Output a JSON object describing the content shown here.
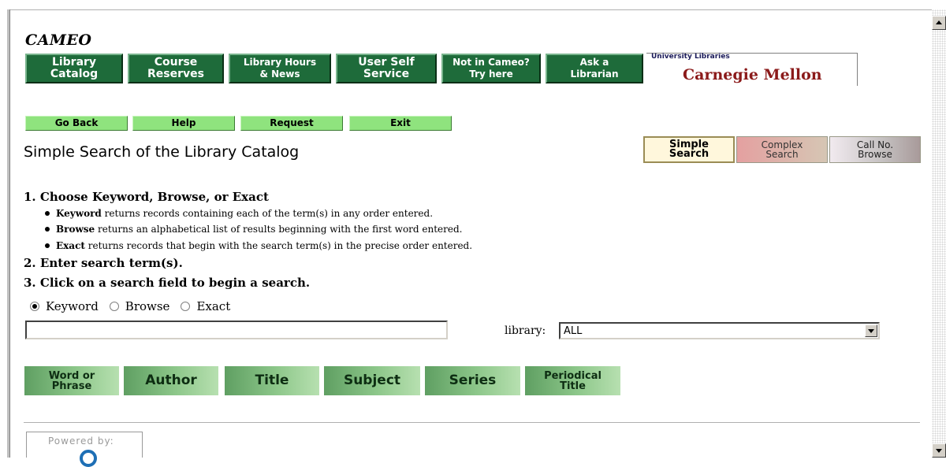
{
  "app": {
    "name": "CAMEO",
    "page_title": "Simple Search of the Library Catalog"
  },
  "nav": {
    "buttons": [
      {
        "label": "Library\nCatalog"
      },
      {
        "label": "Course\nReserves"
      },
      {
        "label": "Library Hours\n& News"
      },
      {
        "label": "User Self\nService"
      },
      {
        "label": "Not in Cameo?\nTry here"
      },
      {
        "label": "Ask a\nLibrarian"
      }
    ],
    "logo_small": "University Libraries",
    "logo_big": "Carnegie Mellon"
  },
  "actions": {
    "go_back": "Go Back",
    "help": "Help",
    "request": "Request",
    "exit": "Exit"
  },
  "tabs": {
    "simple": "Simple\nSearch",
    "complex": "Complex\nSearch",
    "callno": "Call No.\nBrowse"
  },
  "instructions": {
    "step1": "1. Choose Keyword, Browse, or Exact",
    "bullets": [
      {
        "bold": "Keyword",
        "text": " returns records containing each of the term(s) in any order entered."
      },
      {
        "bold": "Browse",
        "text": " returns an alphabetical list of results beginning with the first word entered."
      },
      {
        "bold": "Exact",
        "text": " returns records that begin with the search term(s) in the precise order entered."
      }
    ],
    "step2": "2. Enter search term(s).",
    "step3": "3. Click on a search field to begin a search."
  },
  "search_type": {
    "options": [
      "Keyword",
      "Browse",
      "Exact"
    ],
    "selected": "Keyword"
  },
  "search": {
    "value": "",
    "library_label": "library:",
    "library_value": "ALL"
  },
  "fields": {
    "word_phrase": "Word or\nPhrase",
    "author": "Author",
    "title": "Title",
    "subject": "Subject",
    "series": "Series",
    "periodical": "Periodical\nTitle"
  },
  "footer": {
    "powered_by": "Powered by:"
  }
}
